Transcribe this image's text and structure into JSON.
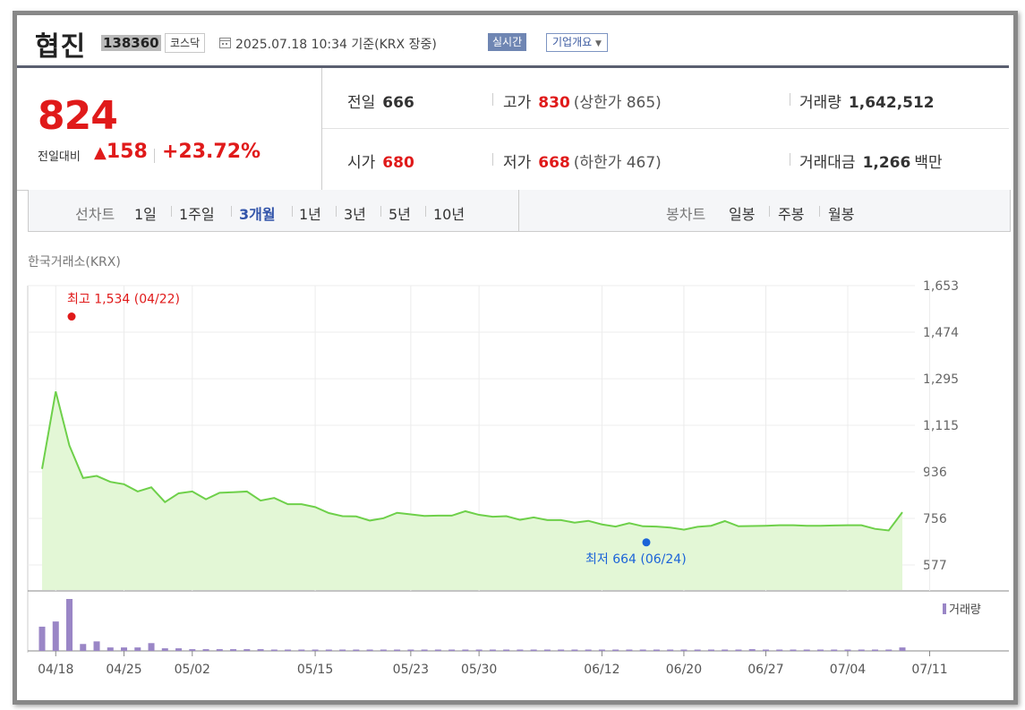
{
  "header": {
    "name": "협진",
    "code": "138360",
    "market": "코스닥",
    "timestamp": "2025.07.18 10:34 기준(KRX 장중)",
    "realtime": "실시간",
    "company_info": "기업개요"
  },
  "price": {
    "current": "824",
    "prev_label": "전일대비",
    "change": "158",
    "change_pct": "+23.72%"
  },
  "stats": {
    "prev_close_label": "전일",
    "prev_close": "666",
    "high_label": "고가",
    "high": "830",
    "upper_limit": "(상한가 865)",
    "volume_label": "거래량",
    "volume": "1,642,512",
    "open_label": "시가",
    "open": "680",
    "low_label": "저가",
    "low": "668",
    "lower_limit": "(하한가 467)",
    "amount_label": "거래대금",
    "amount": "1,266",
    "amount_unit": "백만"
  },
  "periods": {
    "line_label": "선차트",
    "items": [
      "1일",
      "1주일",
      "3개월",
      "1년",
      "3년",
      "5년",
      "10년"
    ],
    "active": "3개월",
    "candle_label": "봉차트",
    "candle_items": [
      "일봉",
      "주봉",
      "월봉"
    ]
  },
  "exchange_label": "한국거래소(KRX)",
  "volume_legend": "거래량",
  "colors": {
    "up": "#e01a1a",
    "line": "#6ed04a",
    "fill": "#e3f7d6",
    "low_marker": "#1c64d8",
    "volume_bar": "#9a86c6"
  },
  "chart_data": {
    "type": "area",
    "ylim": [
      577,
      1653
    ],
    "yticks": [
      "1,653",
      "1,474",
      "1,295",
      "1,115",
      "936",
      "756",
      "577"
    ],
    "xticks": [
      "04/18",
      "04/25",
      "05/02",
      "05/15",
      "05/23",
      "05/30",
      "06/12",
      "06/20",
      "06/27",
      "07/04",
      "07/11"
    ],
    "xtick_index": [
      1,
      6,
      11,
      20,
      27,
      32,
      41,
      47,
      53,
      59,
      65
    ],
    "series": [
      {
        "values": [
          947,
          1245,
          1037,
          912,
          920,
          897,
          888,
          860,
          876,
          819,
          853,
          860,
          830,
          855,
          857,
          860,
          825,
          835,
          811,
          811,
          800,
          777,
          765,
          764,
          748,
          757,
          778,
          772,
          766,
          767,
          767,
          784,
          770,
          763,
          765,
          751,
          760,
          750,
          750,
          740,
          747,
          733,
          725,
          738,
          726,
          725,
          721,
          713,
          724,
          728,
          746,
          726,
          727,
          728,
          730,
          730,
          728,
          728,
          729,
          730,
          730,
          716,
          710,
          780
        ]
      }
    ],
    "high_annotation": {
      "label": "최고 1,534 (04/22)",
      "value": 1534
    },
    "low_annotation": {
      "label": "최저 664 (06/24)",
      "value": 664
    },
    "volume_values": [
      28,
      34,
      60,
      8,
      11,
      4,
      4,
      4,
      9,
      3,
      3,
      2,
      2,
      2,
      2,
      2,
      2,
      1,
      1,
      1,
      1,
      1,
      1,
      1,
      1,
      1,
      1,
      1,
      1,
      1,
      1,
      1,
      1,
      1,
      1,
      1,
      1,
      1,
      1,
      1,
      1,
      1,
      1,
      1,
      1,
      1,
      1,
      1,
      1,
      1,
      1,
      1,
      2,
      1,
      1,
      1,
      1,
      1,
      1,
      1,
      1,
      1,
      1,
      4
    ]
  }
}
